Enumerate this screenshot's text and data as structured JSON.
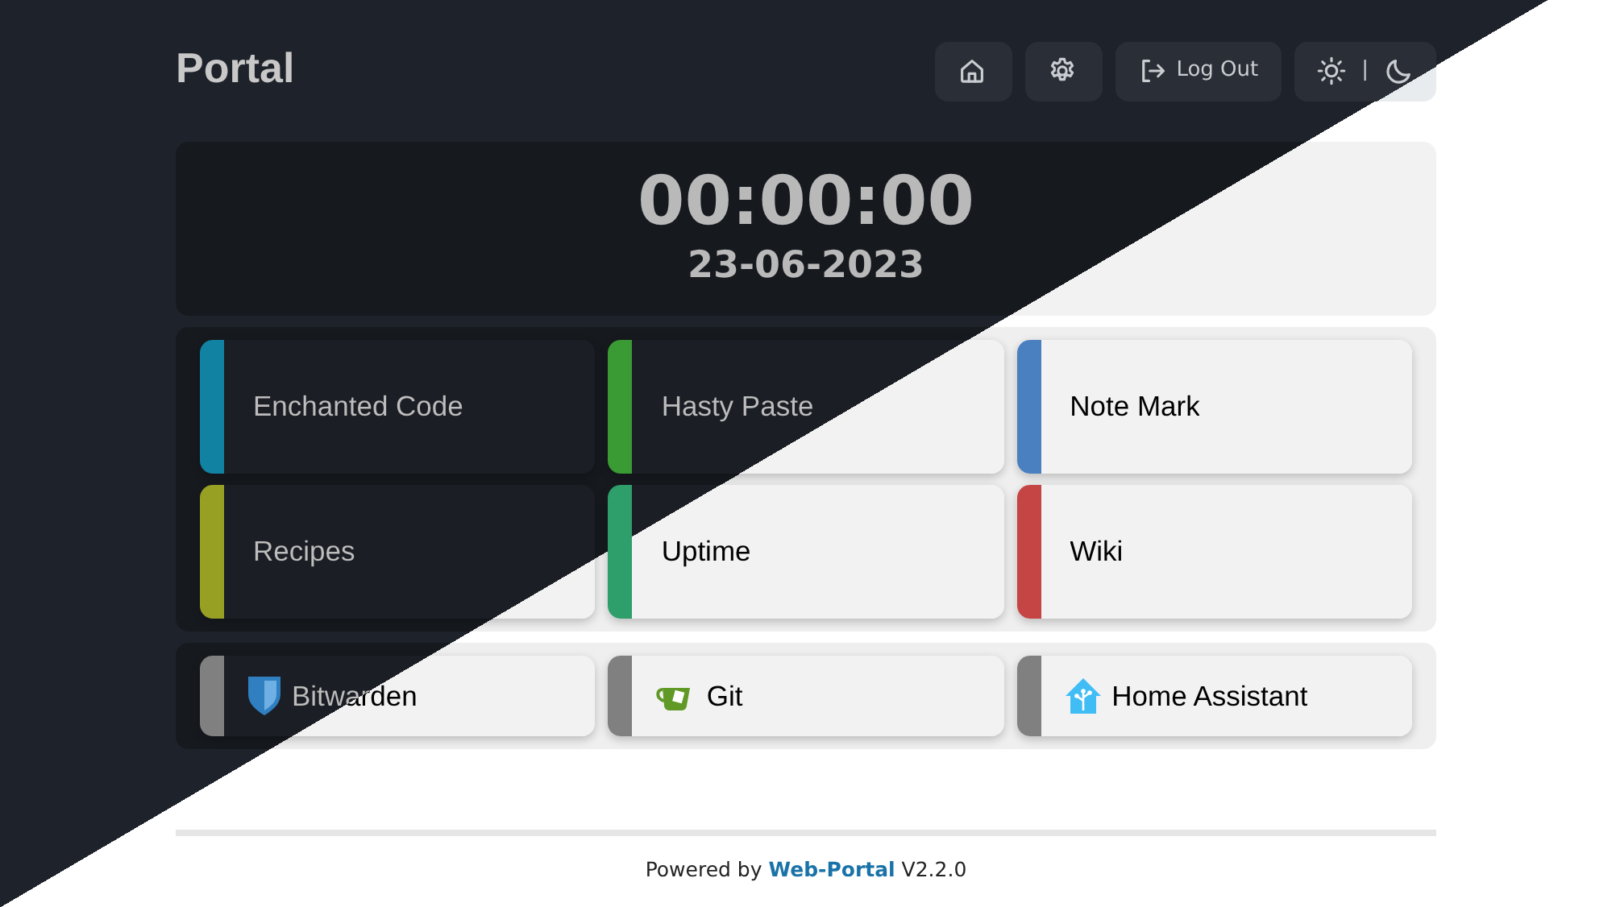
{
  "header": {
    "title": "Portal",
    "nav": [
      {
        "kind": "home"
      },
      {
        "kind": "settings"
      },
      {
        "kind": "logout",
        "label": "Log Out"
      },
      {
        "kind": "theme",
        "separator": "|"
      }
    ]
  },
  "clock": {
    "time": "00:00:00",
    "date": "23-06-2023"
  },
  "apps": [
    {
      "name": "Enchanted Code",
      "color": "#1282a2"
    },
    {
      "name": "Hasty Paste",
      "color": "#3a9a34"
    },
    {
      "name": "Note Mark",
      "color": "#4a7fc0"
    },
    {
      "name": "Recipes",
      "color": "#98a024"
    },
    {
      "name": "Uptime",
      "color": "#2e9e6a"
    },
    {
      "name": "Wiki",
      "color": "#c54444"
    }
  ],
  "links": [
    {
      "name": "Bitwarden",
      "kind": "shield",
      "color": "#808080"
    },
    {
      "name": "Git",
      "kind": "cup",
      "color": "#808080"
    },
    {
      "name": "Home Assistant",
      "kind": "house",
      "color": "#808080"
    }
  ],
  "footer": {
    "text": "Powered by",
    "link": "Web-Portal",
    "version": "V2.2.0"
  }
}
